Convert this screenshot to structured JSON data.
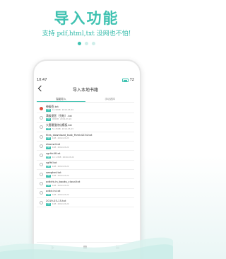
{
  "promo": {
    "title": "导入功能",
    "subtitle": "支持 pdf,html,txt 没网也不怕!",
    "dots_active_index": 0
  },
  "phone": {
    "status": {
      "time": "10:47",
      "battery": "72"
    },
    "nav": {
      "title": "导入本地书籍"
    },
    "tabs": [
      {
        "label": "智能导入",
        "active": true
      },
      {
        "label": "手动选择",
        "active": false
      }
    ],
    "files": [
      {
        "name": "神级签.txt",
        "tag": "TXT",
        "size": "15.98KB",
        "date": "2019-03-24",
        "checked": true
      },
      {
        "name": "满级宠医（完结）.txt",
        "tag": "TXT",
        "size": "900KB",
        "date": "2019-03-24",
        "checked": false
      },
      {
        "name": "大唐最强修仙模板.txt",
        "tag": "TXT",
        "size": "51.45KB",
        "date": "2019-03-23",
        "checked": false
      },
      {
        "name": "files_download_task_fhmk4234.txt",
        "tag": "TXT",
        "size": "1KB",
        "date": "2019-03-23",
        "checked": false
      },
      {
        "name": "ebanwl.txt",
        "tag": "TXT",
        "size": "1KB",
        "date": "2019-03-22",
        "checked": false
      },
      {
        "name": "sgrhk4f.txt",
        "tag": "TXT",
        "size": "1K 1.95B",
        "date": "2019-03-22",
        "checked": false
      },
      {
        "name": "sgfhf.txt",
        "tag": "TXT",
        "size": "1KB",
        "date": "2019-03-22",
        "checked": false
      },
      {
        "name": "seeghet.txt",
        "tag": "TXT",
        "size": "1KB",
        "date": "2019-03-22",
        "checked": false
      },
      {
        "name": "adkirb.in_books_cloud.txt",
        "tag": "TXT",
        "size": "1KB",
        "date": "2019-03-22",
        "checked": false
      },
      {
        "name": "adkir.in.txt",
        "tag": "TXT",
        "size": "1KB",
        "date": "2019-03-22",
        "checked": false
      },
      {
        "name": "2019-03-15.txt",
        "tag": "TXT",
        "size": "1KB",
        "date": "2019-03-22",
        "checked": false
      }
    ]
  },
  "colors": {
    "accent": "#3fc2b1",
    "checked": "#e34d3d"
  }
}
